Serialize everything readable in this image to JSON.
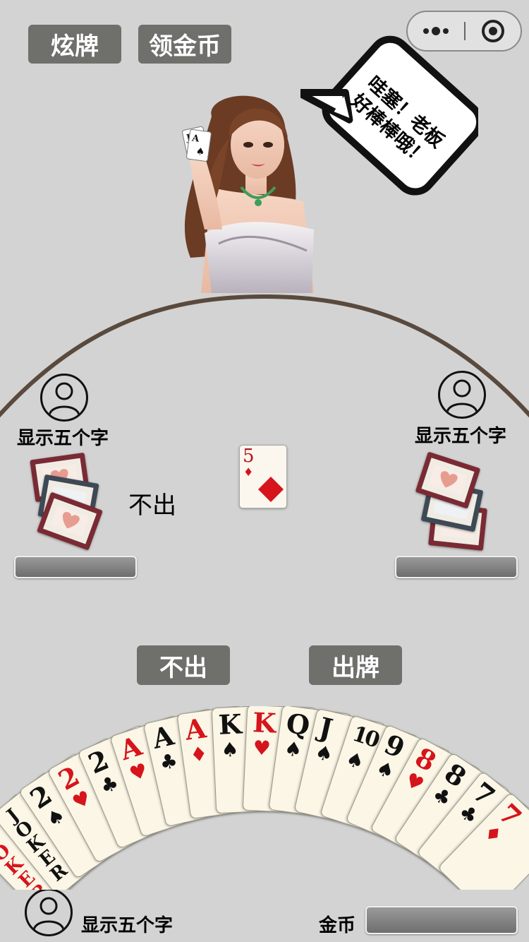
{
  "top_buttons": {
    "show_off": "炫牌",
    "claim_coins": "领金币"
  },
  "capsule": {
    "more_icon": "more-dots-icon",
    "close_icon": "target-close-icon"
  },
  "dealer": {
    "speech": "哇塞！老板好棒棒哦！"
  },
  "left_player": {
    "name": "显示五个字",
    "status": "不出"
  },
  "right_player": {
    "name": "显示五个字"
  },
  "played_card": {
    "rank": "5",
    "suit": "♦"
  },
  "actions": {
    "pass": "不出",
    "play": "出牌"
  },
  "hand": [
    {
      "rank": "JOKER",
      "suit": "",
      "color": "red"
    },
    {
      "rank": "JOKER",
      "suit": "",
      "color": "black"
    },
    {
      "rank": "2",
      "suit": "♠",
      "color": "black"
    },
    {
      "rank": "2",
      "suit": "♥",
      "color": "red"
    },
    {
      "rank": "2",
      "suit": "♣",
      "color": "black"
    },
    {
      "rank": "A",
      "suit": "♥",
      "color": "red"
    },
    {
      "rank": "A",
      "suit": "♣",
      "color": "black"
    },
    {
      "rank": "A",
      "suit": "♦",
      "color": "red"
    },
    {
      "rank": "K",
      "suit": "♠",
      "color": "black"
    },
    {
      "rank": "K",
      "suit": "♥",
      "color": "red"
    },
    {
      "rank": "Q",
      "suit": "♠",
      "color": "black"
    },
    {
      "rank": "J",
      "suit": "♠",
      "color": "black"
    },
    {
      "rank": "10",
      "suit": "♠",
      "color": "black"
    },
    {
      "rank": "9",
      "suit": "♠",
      "color": "black"
    },
    {
      "rank": "8",
      "suit": "♥",
      "color": "red"
    },
    {
      "rank": "8",
      "suit": "♣",
      "color": "black"
    },
    {
      "rank": "7",
      "suit": "♣",
      "color": "black"
    },
    {
      "rank": "7",
      "suit": "♦",
      "color": "red"
    }
  ],
  "self_player": {
    "name": "显示五个字",
    "coins_label": "金币"
  },
  "colors": {
    "table_bg": "#d3d3d3",
    "button_bg": "#6f706c",
    "arc": "#5a4a3e",
    "card_red": "#d6141b",
    "card_back_border": "#7a2a34"
  }
}
